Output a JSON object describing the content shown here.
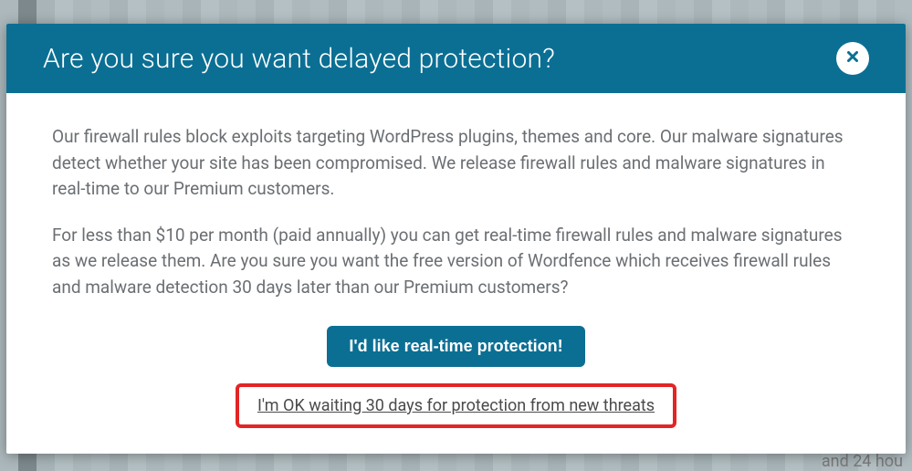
{
  "modal": {
    "title": "Are you sure you want delayed protection?",
    "paragraph1": "Our firewall rules block exploits targeting WordPress plugins, themes and core. Our malware signatures detect whether your site has been compromised. We release firewall rules and malware signatures in real-time to our Premium customers.",
    "paragraph2": "For less than $10 per month (paid annually) you can get real-time firewall rules and malware signatures as we release them. Are you sure you want the free version of Wordfence which receives firewall rules and malware detection 30 days later than our Premium customers?",
    "primary_button": "I'd like real-time protection!",
    "secondary_link": "I'm OK waiting 30 days for protection from new threats"
  },
  "background": {
    "hint": "and 24 hou"
  },
  "colors": {
    "header_bg": "#0b6f94",
    "primary_btn_bg": "#0b6f94",
    "highlight_border": "#e22525"
  }
}
